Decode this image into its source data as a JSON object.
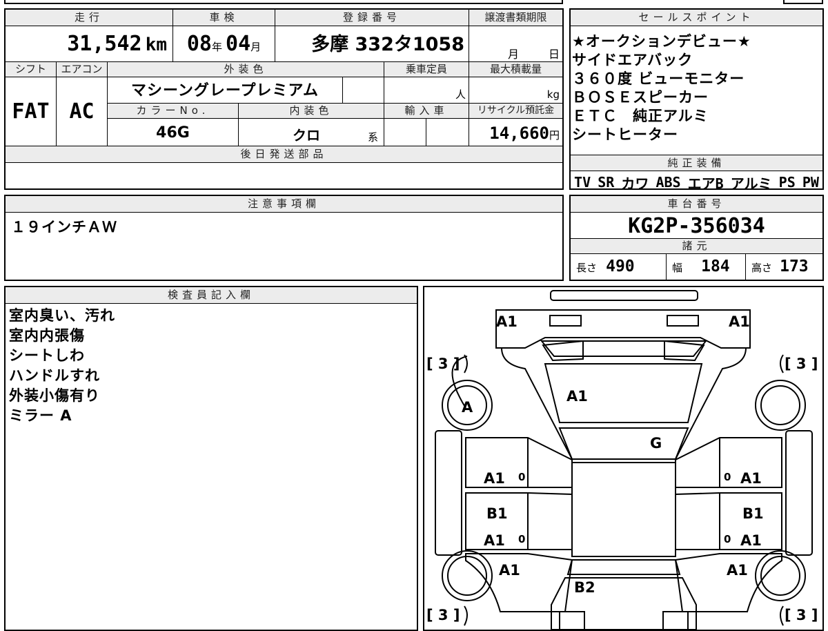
{
  "headers": {
    "mileage": "走行",
    "shaken": "車検",
    "plate": "登録番号",
    "transfer_deadline": "譲渡書類期限",
    "sales_points": "セールスポイント",
    "shift": "シフト",
    "aircon": "エアコン",
    "exterior_color": "外装色",
    "capacity": "乗車定員",
    "max_load": "最大積載量",
    "color_no": "カラーNo.",
    "interior_color": "内装色",
    "import": "輸入車",
    "recycle_fee": "リサイクル預託金",
    "later_parts": "後日発送部品",
    "standard_equipment": "純正装備",
    "notes": "注意事項欄",
    "chassis_number": "車台番号",
    "specs": "諸元",
    "inspector": "検査員記入欄"
  },
  "vehicle": {
    "mileage": "31,542",
    "mileage_unit": "km",
    "shaken_year": "08",
    "year_unit": "年",
    "shaken_month": "04",
    "month_unit": "月",
    "plate": "多摩 332タ1058",
    "deadline_month_unit": "月",
    "deadline_day_unit": "日",
    "shift": "FAT",
    "aircon": "AC",
    "exterior_color": "マシーングレープレミアム",
    "capacity_unit": "人",
    "max_load_unit": "kg",
    "color_no": "46G",
    "interior_color": "クロ",
    "interior_suffix": "系",
    "recycle_fee": "14,660",
    "recycle_unit": "円"
  },
  "sales_points": [
    "★オークションデビュー★",
    "サイドエアバック",
    "３６０度 ビューモニター",
    "ＢＯＳＥスピーカー",
    "ＥＴＣ　純正アルミ",
    "シートヒーター"
  ],
  "standard_equipment": [
    "TV",
    "SR",
    "カワ",
    "ABS",
    "エアB",
    "アルミ",
    "PS",
    "PW"
  ],
  "notes": "１９インチＡＷ",
  "chassis_number": "KG2P-356034",
  "specs": {
    "length_label": "長さ",
    "length": "490",
    "width_label": "幅",
    "width": "184",
    "height_label": "高さ",
    "height": "173"
  },
  "inspector_notes": [
    "室内臭い、汚れ",
    "室内内張傷",
    "シートしわ",
    "ハンドルすれ",
    "外装小傷有り",
    "ミラー A"
  ],
  "diagram_marks": {
    "front_left": "A1",
    "front_right": "A1",
    "hood": "A1",
    "front_left_wheel": "A",
    "windshield": "G",
    "left_front_door": "A1",
    "right_front_door": "A1",
    "left_rear_door_1": "B1",
    "left_rear_door_2": "A1",
    "right_rear_door_1": "B1",
    "right_rear_door_2": "A1",
    "left_rear_fender": "A1",
    "right_rear_fender": "A1",
    "rear": "B2",
    "tire_tl": "[ 3 ]",
    "tire_tr": "[ 3 ]",
    "tire_bl": "[ 3 ]",
    "tire_br": "[ 3 ]",
    "zero_mark": "0"
  }
}
